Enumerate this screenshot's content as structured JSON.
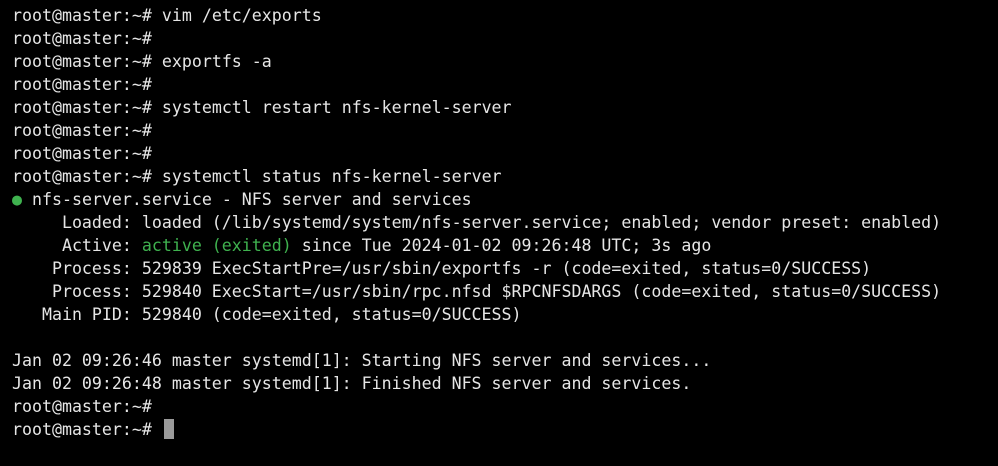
{
  "colors": {
    "background": "#000000",
    "text": "#e6e6e6",
    "status_active": "#3fb24f",
    "cursor": "#9a9a9a"
  },
  "terminal": {
    "prompt": "root@master:~#",
    "lines": [
      {
        "type": "command",
        "command": "vim /etc/exports"
      },
      {
        "type": "command",
        "command": ""
      },
      {
        "type": "command",
        "command": "exportfs -a"
      },
      {
        "type": "command",
        "command": ""
      },
      {
        "type": "command",
        "command": "systemctl restart nfs-kernel-server"
      },
      {
        "type": "command",
        "command": ""
      },
      {
        "type": "command",
        "command": ""
      },
      {
        "type": "command",
        "command": "systemctl status nfs-kernel-server"
      },
      {
        "type": "service",
        "bullet": "●",
        "text": "nfs-server.service - NFS server and services"
      },
      {
        "type": "output",
        "text": "     Loaded: loaded (/lib/systemd/system/nfs-server.service; enabled; vendor preset: enabled)"
      },
      {
        "type": "active",
        "prefix": "     Active: ",
        "status": "active (exited)",
        "suffix": " since Tue 2024-01-02 09:26:48 UTC; 3s ago"
      },
      {
        "type": "output",
        "text": "    Process: 529839 ExecStartPre=/usr/sbin/exportfs -r (code=exited, status=0/SUCCESS)"
      },
      {
        "type": "output",
        "text": "    Process: 529840 ExecStart=/usr/sbin/rpc.nfsd $RPCNFSDARGS (code=exited, status=0/SUCCESS)"
      },
      {
        "type": "output",
        "text": "   Main PID: 529840 (code=exited, status=0/SUCCESS)"
      },
      {
        "type": "output",
        "text": ""
      },
      {
        "type": "output",
        "text": "Jan 02 09:26:46 master systemd[1]: Starting NFS server and services..."
      },
      {
        "type": "output",
        "text": "Jan 02 09:26:48 master systemd[1]: Finished NFS server and services."
      },
      {
        "type": "command",
        "command": ""
      },
      {
        "type": "prompt-cursor",
        "command": ""
      }
    ]
  }
}
